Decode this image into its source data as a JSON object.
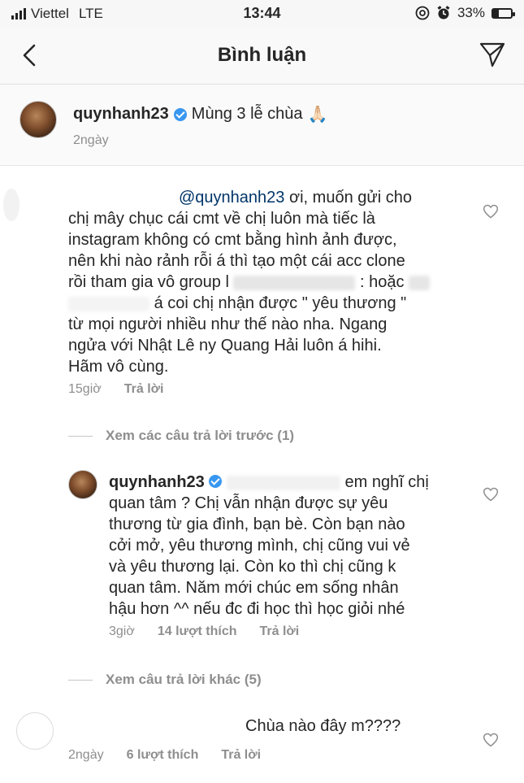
{
  "status_bar": {
    "carrier": "Viettel",
    "network": "LTE",
    "time": "13:44",
    "battery_percent": "33%",
    "battery_level": 0.33
  },
  "nav": {
    "title": "Bình luận",
    "back_icon": "chevron-left-icon",
    "send_icon": "paper-plane-icon"
  },
  "caption": {
    "username": "quynhanh23",
    "text": "Mùng 3 lễ chùa",
    "emoji": "🙏🏻",
    "time": "2ngày"
  },
  "comment1": {
    "mention": "@quynhanh23",
    "lines": [
      "ơi, muốn gửi cho",
      "chị mây chục cái cmt về chị luôn mà tiếc là",
      "instagram không có cmt bằng hình ảnh được,",
      "nên khi nào rảnh rỗi á thì tạo một cái acc clone",
      "rồi tham gia vô group l",
      ": hoặc",
      "á coi chị nhận được \" yêu thương \"",
      "từ mọi người nhiều như thế nào nha. Ngang",
      "ngửa với Nhật Lê ny Quang Hải luôn á hihi.",
      "Hãm vô cùng."
    ],
    "time": "15giờ",
    "reply_label": "Trả lời"
  },
  "view_previous": "Xem các câu trả lời trước (1)",
  "reply1": {
    "username": "quynhanh23",
    "lines": [
      "em nghĩ chị",
      "quan tâm ? Chị vẫn nhận được sự yêu",
      "thương từ gia đình, bạn bè. Còn bạn nào",
      "cởi mở, yêu thương mình, chị cũng vui vẻ",
      "và yêu thương lại. Còn ko thì chị cũng k",
      "quan tâm. Năm mới chúc em sống nhân",
      "hậu hơn ^^ nếu đc đi học thì học giỏi nhé"
    ],
    "time": "3giờ",
    "likes": "14 lượt thích",
    "reply_label": "Trả lời"
  },
  "view_other": "Xem câu trả lời khác (5)",
  "comment2": {
    "text": "Chùa nào đây m????",
    "time": "2ngày",
    "likes": "6 lượt thích",
    "reply_label": "Trả lời"
  }
}
